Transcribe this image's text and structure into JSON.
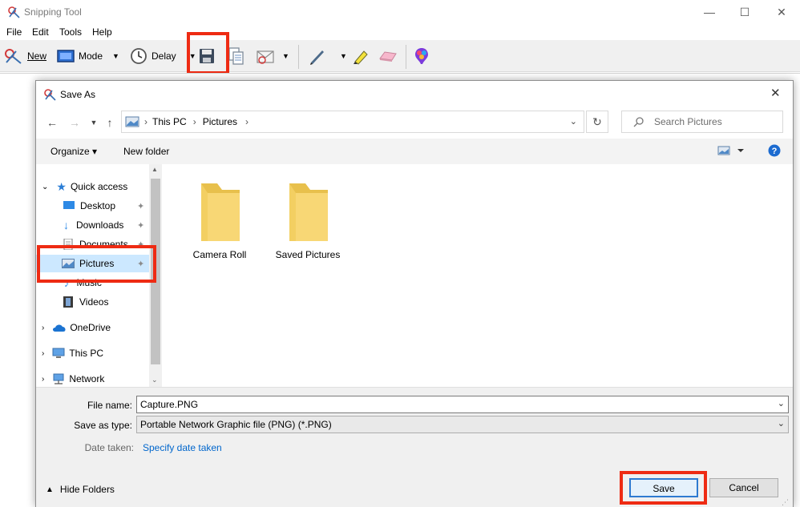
{
  "snipping_tool": {
    "title": "Snipping Tool",
    "window_controls": {
      "minimize": "—",
      "maximize": "☐",
      "close": "✕"
    },
    "menu": [
      "File",
      "Edit",
      "Tools",
      "Help"
    ],
    "toolbar": {
      "new_label": "New",
      "mode_label": "Mode",
      "delay_label": "Delay"
    }
  },
  "dialog": {
    "title": "Save As",
    "close": "✕",
    "breadcrumb": [
      "This PC",
      "Pictures"
    ],
    "search_placeholder": "Search Pictures",
    "organize_label": "Organize ▾",
    "new_folder_label": "New folder",
    "nav": {
      "quick_access": "Quick access",
      "items": [
        "Desktop",
        "Downloads",
        "Documents",
        "Pictures",
        "Music",
        "Videos"
      ],
      "onedrive": "OneDrive",
      "this_pc": "This PC",
      "network": "Network"
    },
    "folders": [
      "Camera Roll",
      "Saved Pictures"
    ],
    "file_name_label": "File name:",
    "file_name_value": "Capture.PNG",
    "save_as_type_label": "Save as type:",
    "save_as_type_value": "Portable Network Graphic file (PNG) (*.PNG)",
    "date_taken_label": "Date taken:",
    "date_taken_link": "Specify date taken",
    "hide_folders_label": "Hide Folders",
    "save_label": "Save",
    "cancel_label": "Cancel"
  },
  "colors": {
    "highlight_box": "#ee2b13",
    "selected_nav": "#cce8ff",
    "link": "#0066cc",
    "folder_yellow": "#f8d775"
  }
}
